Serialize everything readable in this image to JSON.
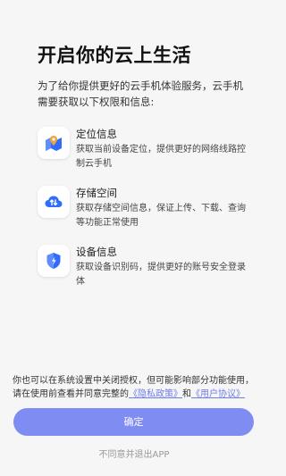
{
  "title": "开启你的云上生活",
  "intro": "为了给你提供更好的云手机体验服务，云手机需要获取以下权限和信息:",
  "permissions": [
    {
      "title": "定位信息",
      "desc": "获取当前设备定位，提供更好的网络线路控制云手机",
      "icon": "location-map-icon"
    },
    {
      "title": "存储空间",
      "desc": "获取存储空间信息，保证上传、下载、查询等功能正常使用",
      "icon": "cloud-storage-icon"
    },
    {
      "title": "设备信息",
      "desc": "获取设备识别码，提供更好的账号安全登录体",
      "icon": "shield-icon"
    }
  ],
  "notice": {
    "text": "你也可以在系统设置中关闭授权，但可能影响部分功能使用，请在使用前查看并同意完整的",
    "privacy_link": "《隐私政策》",
    "and": "和",
    "user_link": "《用户协议》"
  },
  "confirm_label": "确定",
  "exit_label": "不同意并退出APP",
  "colors": {
    "accent": "#7f8cf1",
    "link": "#6f7de8",
    "icon_blue": "#2f6bff"
  }
}
